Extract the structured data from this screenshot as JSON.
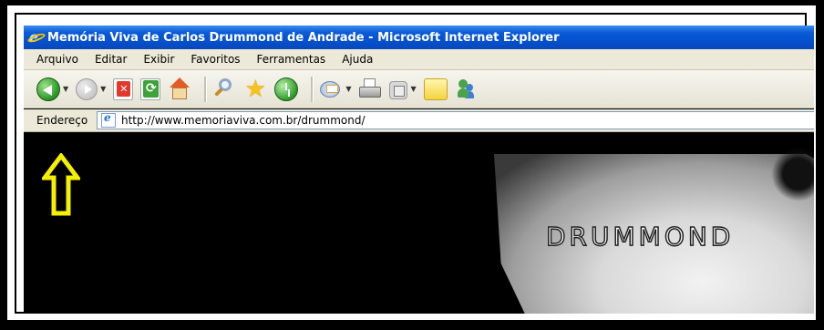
{
  "window": {
    "title": "Memória Viva de Carlos Drummond de Andrade - Microsoft Internet Explorer"
  },
  "menu": {
    "items": [
      "Arquivo",
      "Editar",
      "Exibir",
      "Favoritos",
      "Ferramentas",
      "Ajuda"
    ]
  },
  "toolbar": {
    "icons": [
      "back-icon",
      "forward-icon",
      "stop-icon",
      "refresh-icon",
      "home-icon",
      "search-icon",
      "star-icon",
      "history-icon",
      "mail-icon",
      "print-icon",
      "edit-icon",
      "discuss-icon",
      "messenger-icon"
    ]
  },
  "address": {
    "label": "Endereço",
    "url": "http://www.memoriaviva.com.br/drummond/"
  },
  "content": {
    "banner_text": "DRUMMOND"
  },
  "annotation": {
    "arrow_color": "#f5f000",
    "arrow_icon": "up-arrow-icon"
  },
  "colors": {
    "titlebar": "#0550cc",
    "chrome": "#ece9d8",
    "page_background": "#000000"
  }
}
